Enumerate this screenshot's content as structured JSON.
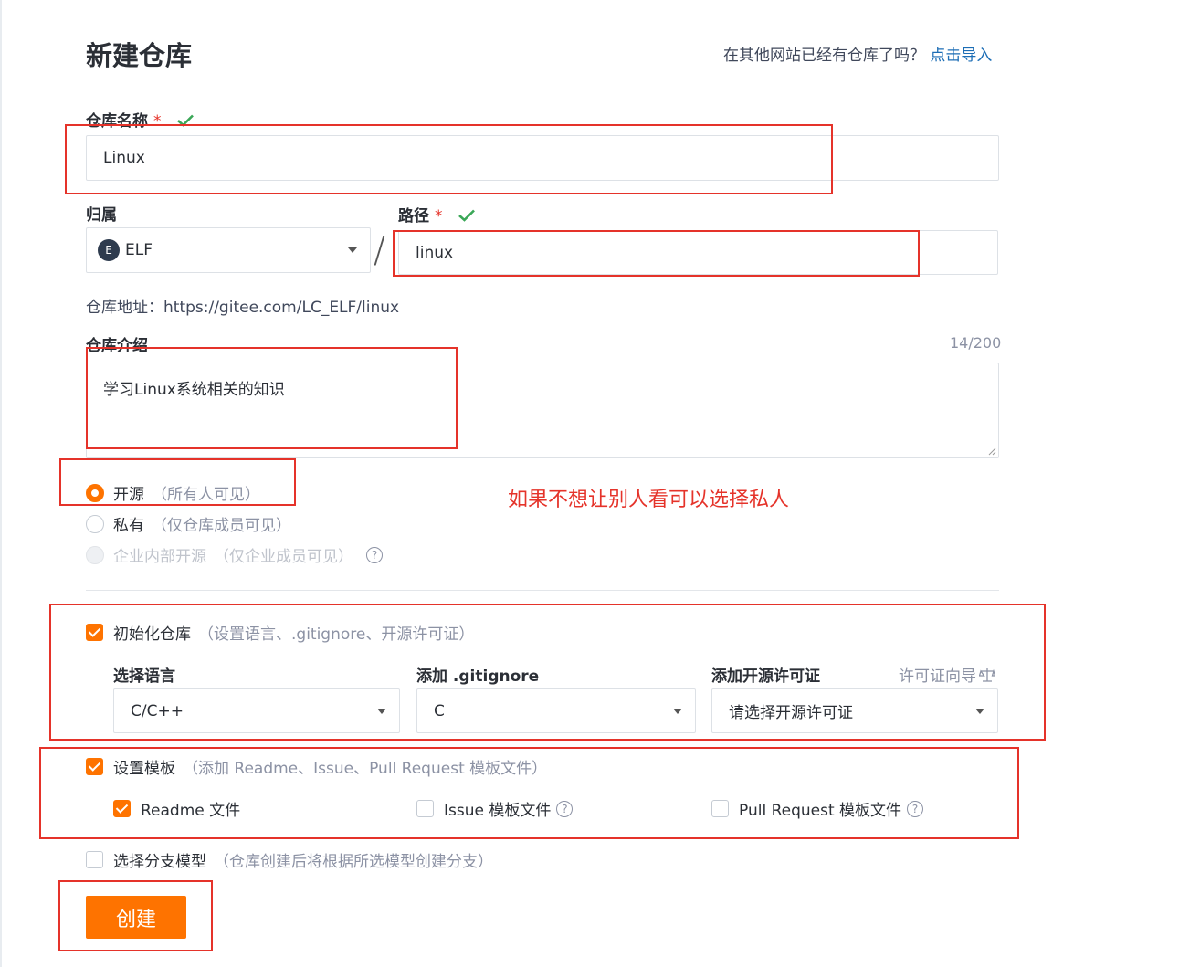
{
  "header": {
    "title": "新建仓库",
    "import_prompt": "在其他网站已经有仓库了吗？",
    "import_link": "点击导入"
  },
  "repo_name": {
    "label": "仓库名称",
    "required_mark": "*",
    "value": "Linux"
  },
  "owner": {
    "label": "归属",
    "avatar_letter": "E",
    "value": "ELF"
  },
  "separator": "/",
  "path": {
    "label": "路径",
    "required_mark": "*",
    "value": "linux"
  },
  "repo_address": "仓库地址：https://gitee.com/LC_ELF/linux",
  "description": {
    "label": "仓库介绍",
    "counter": "14/200",
    "value": "学习Linux系统相关的知识"
  },
  "visibility": {
    "options": [
      {
        "label": "开源",
        "hint": "（所有人可见）",
        "selected": true,
        "disabled": false
      },
      {
        "label": "私有",
        "hint": "（仅仓库成员可见）",
        "selected": false,
        "disabled": false
      },
      {
        "label": "企业内部开源",
        "hint": "（仅企业成员可见）",
        "selected": false,
        "disabled": true
      }
    ]
  },
  "annotation": "如果不想让别人看可以选择私人",
  "init_repo": {
    "label": "初始化仓库",
    "hint": "（设置语言、.gitignore、开源许可证）",
    "checked": true,
    "language_label": "选择语言",
    "language_value": "C/C++",
    "gitignore_label": "添加 .gitignore",
    "gitignore_value": "C",
    "license_label": "添加开源许可证",
    "license_guide": "许可证向导",
    "license_value": "请选择开源许可证"
  },
  "template": {
    "label": "设置模板",
    "hint": "（添加 Readme、Issue、Pull Request 模板文件）",
    "checked": true,
    "readme_label": "Readme 文件",
    "readme_checked": true,
    "issue_label": "Issue 模板文件",
    "issue_checked": false,
    "pr_label": "Pull Request 模板文件",
    "pr_checked": false
  },
  "branch_model": {
    "label": "选择分支模型",
    "hint": "（仓库创建后将根据所选模型创建分支）",
    "checked": false
  },
  "create_button": "创建",
  "colors": {
    "accent": "#fe7300",
    "link": "#1c6db5",
    "annotation": "#e5332a",
    "success": "#3aa757"
  },
  "icons": [
    "check-icon",
    "caret-down-icon",
    "help-icon",
    "scale-icon",
    "resize-grip-icon"
  ]
}
